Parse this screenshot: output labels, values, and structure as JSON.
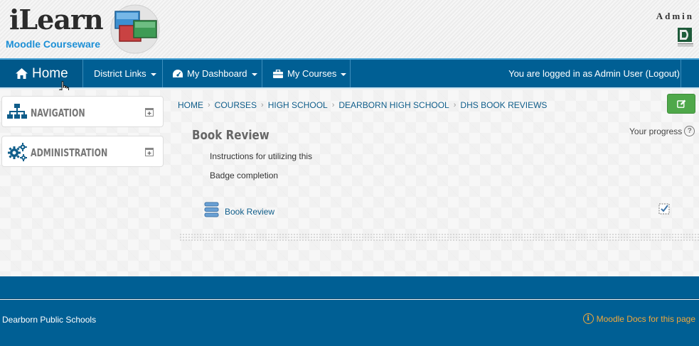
{
  "header": {
    "logo_title": "iLearn",
    "logo_subtitle": "Moodle Courseware",
    "admin_label": "Admin"
  },
  "navbar": {
    "home": "Home",
    "district_links": "District Links",
    "my_dashboard": "My Dashboard",
    "my_courses": "My Courses",
    "login_status": "You are logged in as Admin User (Logout)"
  },
  "blocks": {
    "navigation": "NAVIGATION",
    "administration": "ADMINISTRATION"
  },
  "breadcrumb": [
    "HOME",
    "COURSES",
    "HIGH SCHOOL",
    "DEARBORN HIGH SCHOOL",
    "DHS BOOK REVIEWS"
  ],
  "main": {
    "course_title": "Book Review",
    "progress_label": "Your progress",
    "summary_lines": [
      "Instructions for utilizing this",
      "Badge completion"
    ],
    "activity_label": "Book Review"
  },
  "footer": {
    "school_name": "Dearborn Public Schools",
    "docs_link": "Moodle Docs for this page"
  },
  "colors": {
    "navbar": "#005f94",
    "link": "#0f5d8a",
    "edit_button": "#4fa84a",
    "footer_link": "#f1a93b"
  },
  "icons": {
    "home": "home-icon",
    "dashboard": "dashboard-icon",
    "courses": "briefcase-icon",
    "navigation": "sitemap-icon",
    "administration": "gears-icon",
    "edit": "pencil-square-icon",
    "help": "question-circle-icon",
    "activity": "database-icon",
    "completion": "checkbox-checked-icon",
    "info": "info-circle-icon"
  }
}
